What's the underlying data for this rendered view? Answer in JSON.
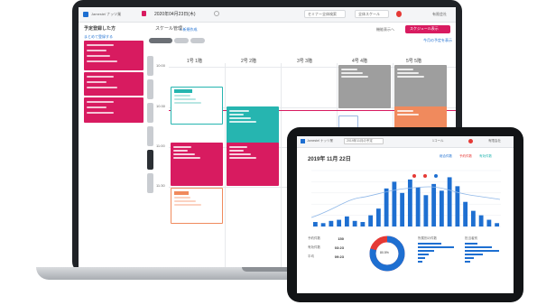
{
  "laptop": {
    "app_name": "Jamestel ナッツ業",
    "date_text": "2020年04月23日(木)",
    "search_placeholder": "セミナー全体検索",
    "filter_label": "全体スケール",
    "user_label": "有限会社",
    "sidebar_title": "予定登録した方",
    "sidebar_link": "まとめて登録する",
    "header_title": "スケール管理",
    "header_link": "+ 新規作成",
    "right_link": "今月の予定を表示",
    "toolbar_label": "機能表示へ",
    "toolbar_button": "スケジュール表示",
    "time_labels": [
      "10:00",
      "10:30",
      "11:00",
      "11:30"
    ],
    "columns": [
      "1号 1階",
      "2号 2階",
      "3号 3階",
      "4号 4階",
      "5号 5階"
    ],
    "accent": "#d81b60",
    "teal": "#26b5b0",
    "grey": "#9e9e9e",
    "orange": "#f08a5d"
  },
  "tablet": {
    "app_name": "Jamestel ナッツ業",
    "tab_label": "2019年11月の予定",
    "filter_label": "1コール",
    "user_label": "有限会社",
    "title": "2019年 11月 22日",
    "legend": [
      "総合件数",
      "予約件数",
      "有効件数"
    ],
    "legend_colors": [
      "#1e6fd1",
      "#e53935",
      "#26b5b0"
    ],
    "stats": [
      {
        "label": "予約件数",
        "value": "150"
      },
      {
        "label": "有効件数",
        "value": "03:23"
      },
      {
        "label": "平均",
        "value": "09:23"
      }
    ],
    "donut_center": "80.5%",
    "small_chart_titles": [
      "所属別の件数",
      "担当者別"
    ]
  },
  "chart_data": {
    "type": "bar",
    "categories": [
      "1",
      "2",
      "3",
      "4",
      "5",
      "6",
      "7",
      "8",
      "9",
      "10",
      "11",
      "12",
      "13",
      "14",
      "15",
      "16",
      "17",
      "18",
      "19",
      "20",
      "21",
      "22",
      "23",
      "24"
    ],
    "series": [
      {
        "name": "総合件数",
        "values": [
          0.4,
          0.3,
          0.5,
          0.6,
          0.9,
          0.5,
          0.4,
          1.0,
          1.6,
          3.4,
          4.0,
          3.0,
          4.2,
          3.5,
          2.8,
          3.8,
          3.2,
          4.4,
          3.6,
          2.2,
          1.4,
          1.0,
          0.6,
          0.3
        ]
      }
    ],
    "y_grid": true
  }
}
